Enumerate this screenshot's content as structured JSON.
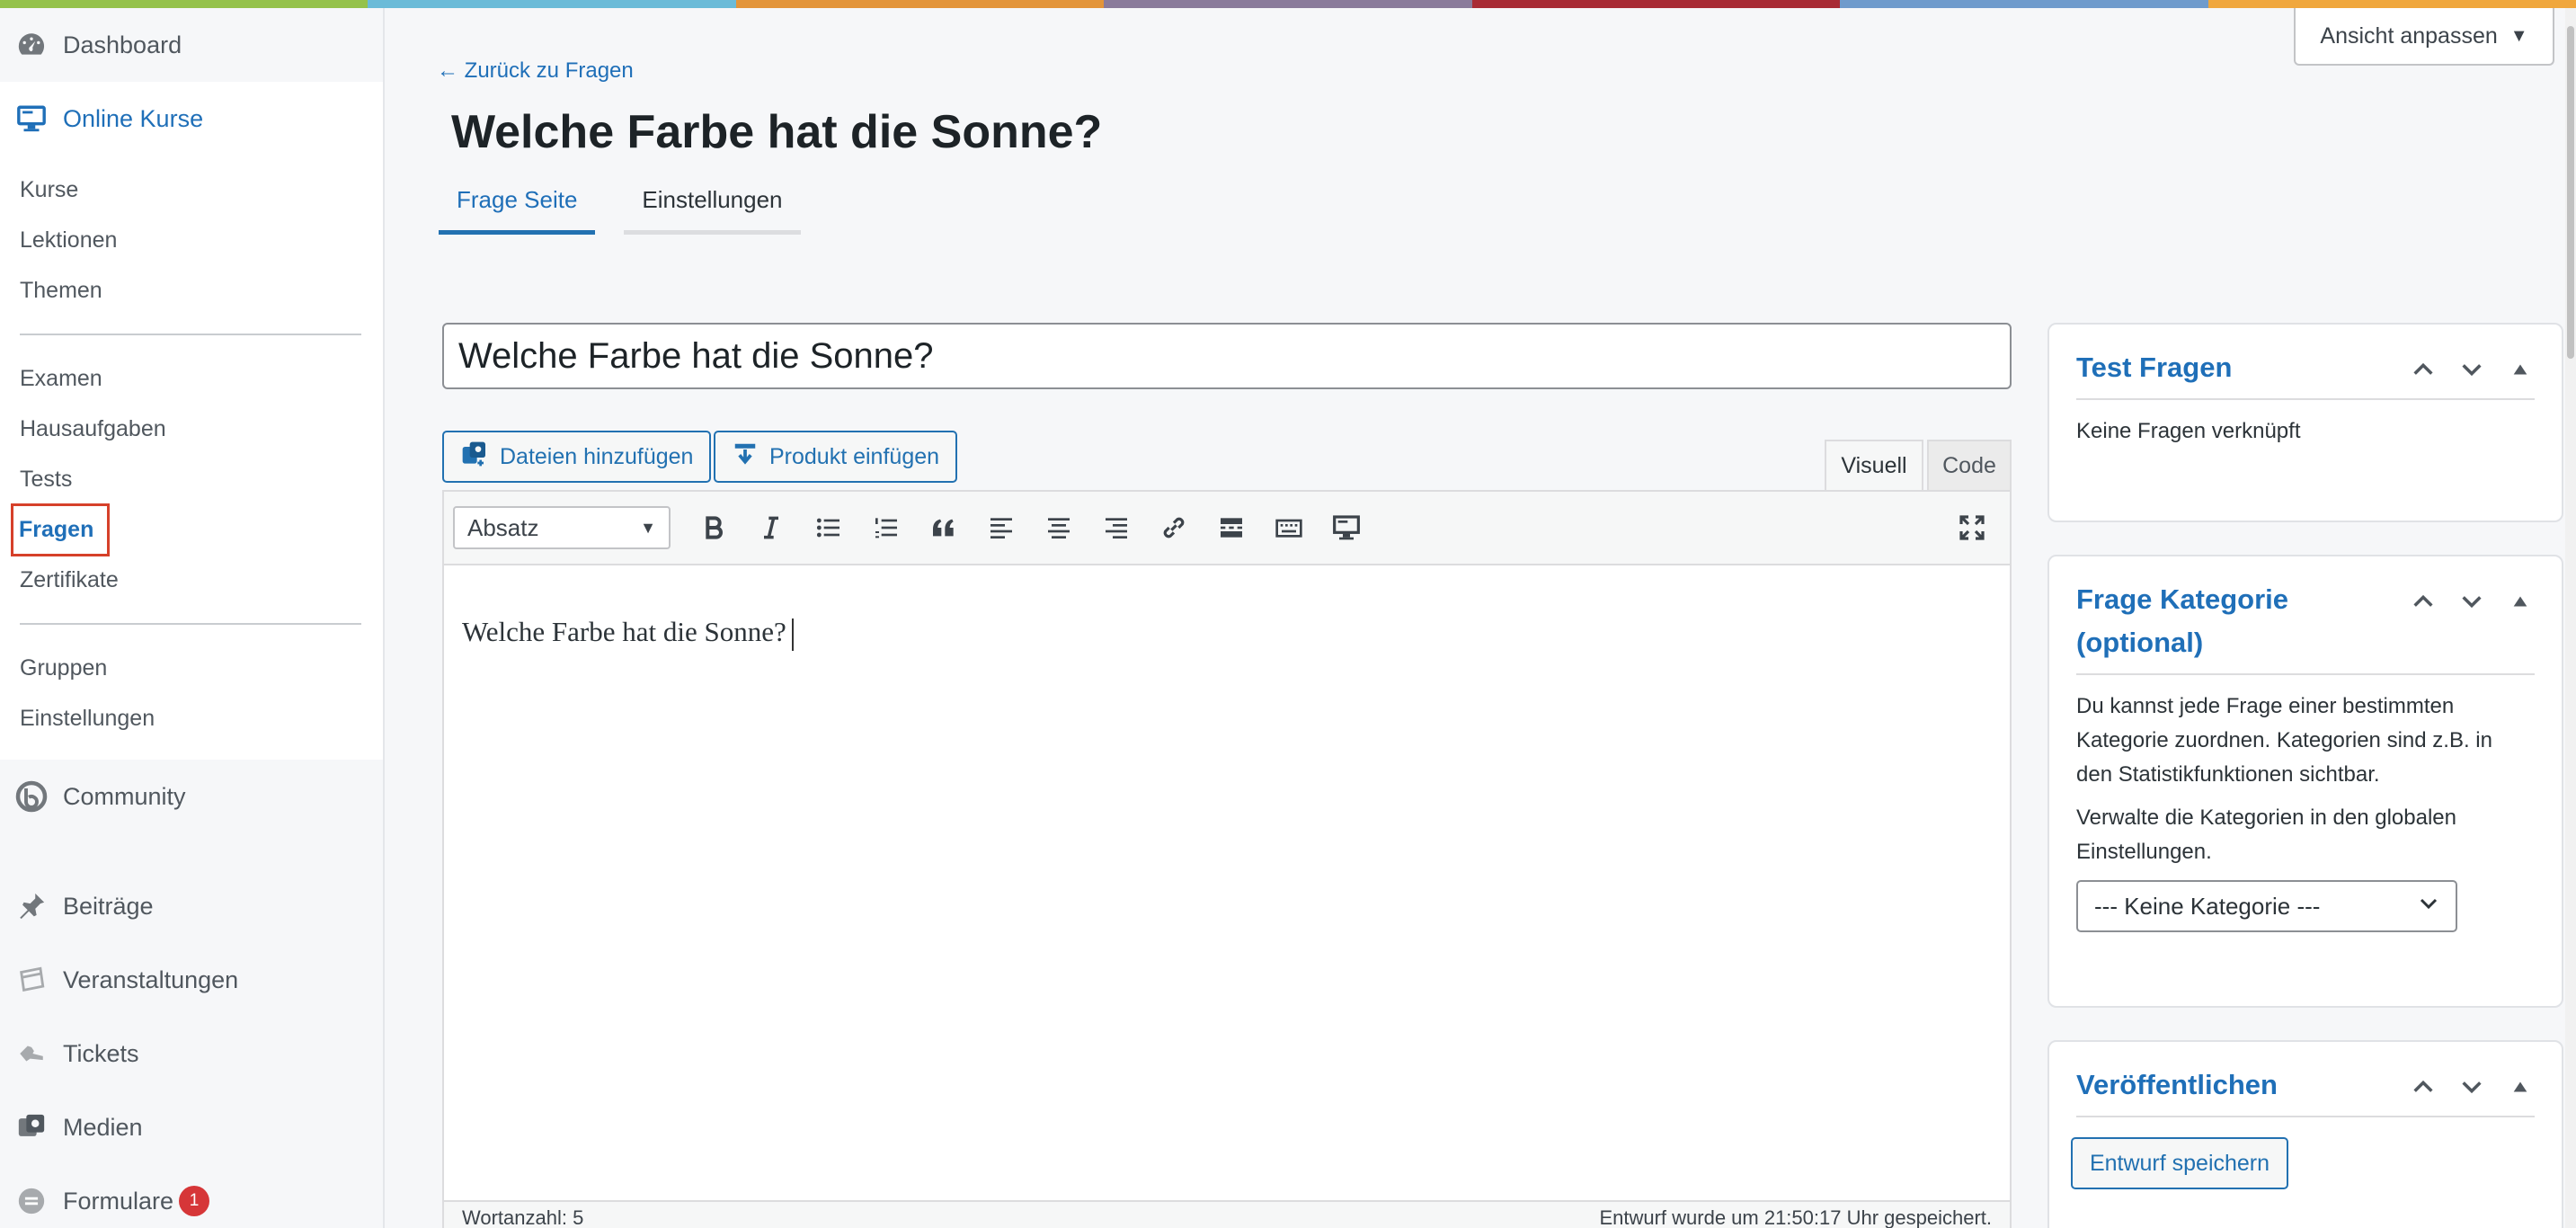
{
  "colors": {
    "strip": [
      "#95c24b",
      "#6bbbd8",
      "#e3953a",
      "#8a7b9b",
      "#a82b35",
      "#6f9bcc",
      "#f0a73d"
    ],
    "accent": "#2271b1",
    "badge": "#d63638"
  },
  "sidebar": {
    "dashboard": "Dashboard",
    "online_kurse": "Online Kurse",
    "sub": {
      "kurse": "Kurse",
      "lektionen": "Lektionen",
      "themen": "Themen",
      "examen": "Examen",
      "hausaufgaben": "Hausaufgaben",
      "tests": "Tests",
      "fragen": "Fragen",
      "zertifikate": "Zertifikate",
      "gruppen": "Gruppen",
      "einstellungen": "Einstellungen"
    },
    "community": "Community",
    "beitraege": "Beiträge",
    "veranstaltungen": "Veranstaltungen",
    "tickets": "Tickets",
    "medien": "Medien",
    "formulare": "Formulare",
    "formulare_badge": "1"
  },
  "header": {
    "back": "← Zurück zu Fragen",
    "title": "Welche Farbe hat die Sonne?",
    "view_button": "Ansicht anpassen",
    "tabs": [
      "Frage Seite",
      "Einstellungen"
    ]
  },
  "editor": {
    "title_value": "Welche Farbe hat die Sonne?",
    "add_media": "Dateien hinzufügen",
    "insert_product": "Produkt einfügen",
    "mode_visual": "Visuell",
    "mode_code": "Code",
    "format": "Absatz",
    "content": "Welche Farbe hat die Sonne?",
    "word_count": "Wortanzahl: 5",
    "autosave": "Entwurf wurde um 21:50:17 Uhr gespeichert."
  },
  "boxes": {
    "test_fragen": {
      "title": "Test Fragen",
      "text": "Keine Fragen verknüpft"
    },
    "kategorie": {
      "title": "Frage Kategorie (optional)",
      "text1": "Du kannst jede Frage einer bestimmten Kategorie zuordnen. Kategorien sind z.B. in den Statistikfunktionen sichtbar.",
      "text2": "Verwalte die Kategorien in den globalen Einstellungen.",
      "select_value": "--- Keine Kategorie ---"
    },
    "publish": {
      "title": "Veröffentlichen",
      "draft": "Entwurf speichern"
    }
  }
}
